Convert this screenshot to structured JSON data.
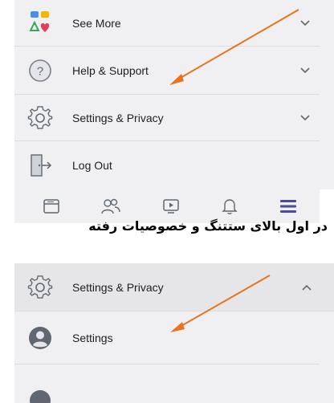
{
  "menu_top": {
    "items": [
      {
        "label": "See More",
        "icon": "see-more-icon"
      },
      {
        "label": "Help & Support",
        "icon": "question-circle-icon"
      },
      {
        "label": "Settings & Privacy",
        "icon": "gear-icon"
      },
      {
        "label": "Log Out",
        "icon": "door-icon"
      }
    ]
  },
  "navbar": {
    "icons": [
      "feed-icon",
      "friends-icon",
      "watch-icon",
      "bell-icon",
      "menu-icon"
    ],
    "active_color": "#4a4aa0"
  },
  "caption": "در اول بالای ستتنگ و خصوصیات رفته",
  "menu_bottom": {
    "header_label": "Settings & Privacy",
    "items": [
      {
        "label": "Settings",
        "icon": "user-circle-icon"
      }
    ]
  },
  "colors": {
    "arrow": "#e8731c",
    "panel": "#f0f0f2",
    "text": "#1c1e21",
    "icon": "#606770"
  }
}
